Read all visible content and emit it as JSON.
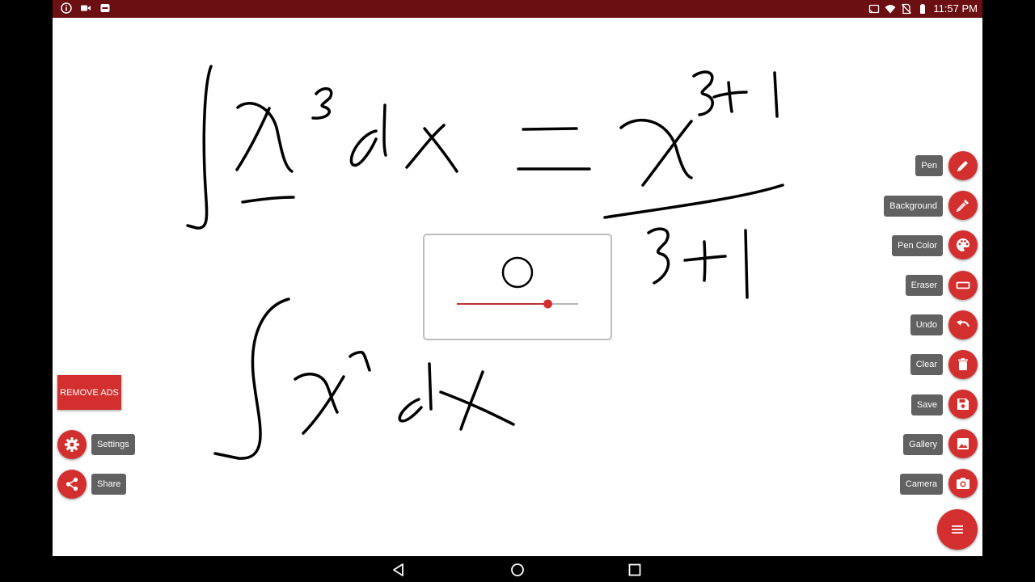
{
  "status_bar": {
    "time": "11:57 PM",
    "left_icons": [
      "info-icon",
      "video-camera-icon",
      "app-notification-icon"
    ],
    "right_icons": [
      "cast-icon",
      "wifi-icon",
      "no-sim-icon",
      "battery-icon"
    ]
  },
  "colors": {
    "accent": "#d32f2f",
    "status_bar": "#6b0f12",
    "label_bg": "#616161"
  },
  "brush_size": {
    "level": 0.75
  },
  "remove_ads": "REMOVE ADS",
  "left_tools": [
    {
      "label": "Settings",
      "icon": "gear-icon"
    },
    {
      "label": "Share",
      "icon": "share-icon"
    }
  ],
  "tools": [
    {
      "label": "Pen",
      "icon": "pencil-icon"
    },
    {
      "label": "Background",
      "icon": "eyedropper-icon"
    },
    {
      "label": "Pen Color",
      "icon": "palette-icon"
    },
    {
      "label": "Eraser",
      "icon": "eraser-icon"
    },
    {
      "label": "Undo",
      "icon": "undo-icon"
    },
    {
      "label": "Clear",
      "icon": "trash-icon"
    },
    {
      "label": "Save",
      "icon": "floppy-icon"
    },
    {
      "label": "Gallery",
      "icon": "image-icon"
    },
    {
      "label": "Camera",
      "icon": "camera-icon"
    }
  ],
  "menu_icon": "menu-icon",
  "nav_icons": [
    "back-icon",
    "home-icon",
    "recents-icon"
  ]
}
